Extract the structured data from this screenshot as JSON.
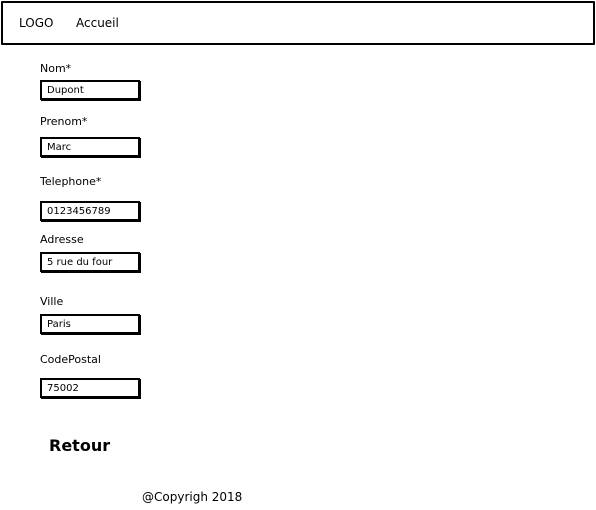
{
  "navbar": {
    "logo": "LOGO",
    "home_link": "Accueil"
  },
  "form": {
    "nom": {
      "label": "Nom*",
      "value": "Dupont"
    },
    "prenom": {
      "label": "Prenom*",
      "value": "Marc"
    },
    "telephone": {
      "label": "Telephone*",
      "value": "0123456789"
    },
    "adresse": {
      "label": "Adresse",
      "value": "5 rue du four"
    },
    "ville": {
      "label": "Ville",
      "value": "Paris"
    },
    "codepostal": {
      "label": "CodePostal",
      "value": "75002"
    }
  },
  "actions": {
    "back_label": "Retour"
  },
  "footer": {
    "copyright": "@Copyrigh 2018"
  }
}
